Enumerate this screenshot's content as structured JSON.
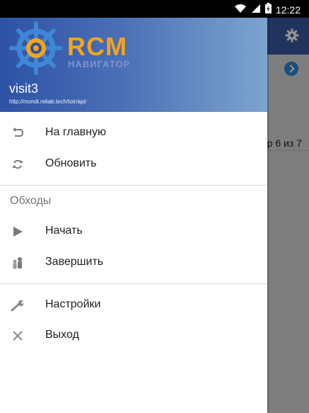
{
  "status_bar": {
    "time": "12:22",
    "icons": [
      "wifi-icon",
      "signal-icon",
      "battery-icon"
    ]
  },
  "background_app": {
    "toolbar_icon": "gear-icon",
    "page_counter": "р 6 из 7"
  },
  "drawer": {
    "header": {
      "logo_text": "RCM",
      "logo_subtitle": "НАВИГАТОР",
      "account_name": "visit3",
      "account_url": "http://mondi.reliab.tech/toir/api/"
    },
    "menu_group_1": [
      {
        "label": "На главную",
        "icon": "undo-arrow-icon"
      },
      {
        "label": "Обновить",
        "icon": "refresh-icon"
      }
    ],
    "section_title": "Обходы",
    "menu_group_2": [
      {
        "label": "Начать",
        "icon": "play-icon"
      },
      {
        "label": "Завершить",
        "icon": "people-icon"
      }
    ],
    "menu_group_3": [
      {
        "label": "Настройки",
        "icon": "wrench-icon"
      },
      {
        "label": "Выход",
        "icon": "close-icon"
      }
    ]
  },
  "colors": {
    "header_start": "#2d52a6",
    "header_end": "#7da4cf",
    "logo_accent": "#f3a51b",
    "toolbar": "#3a5aa3"
  }
}
